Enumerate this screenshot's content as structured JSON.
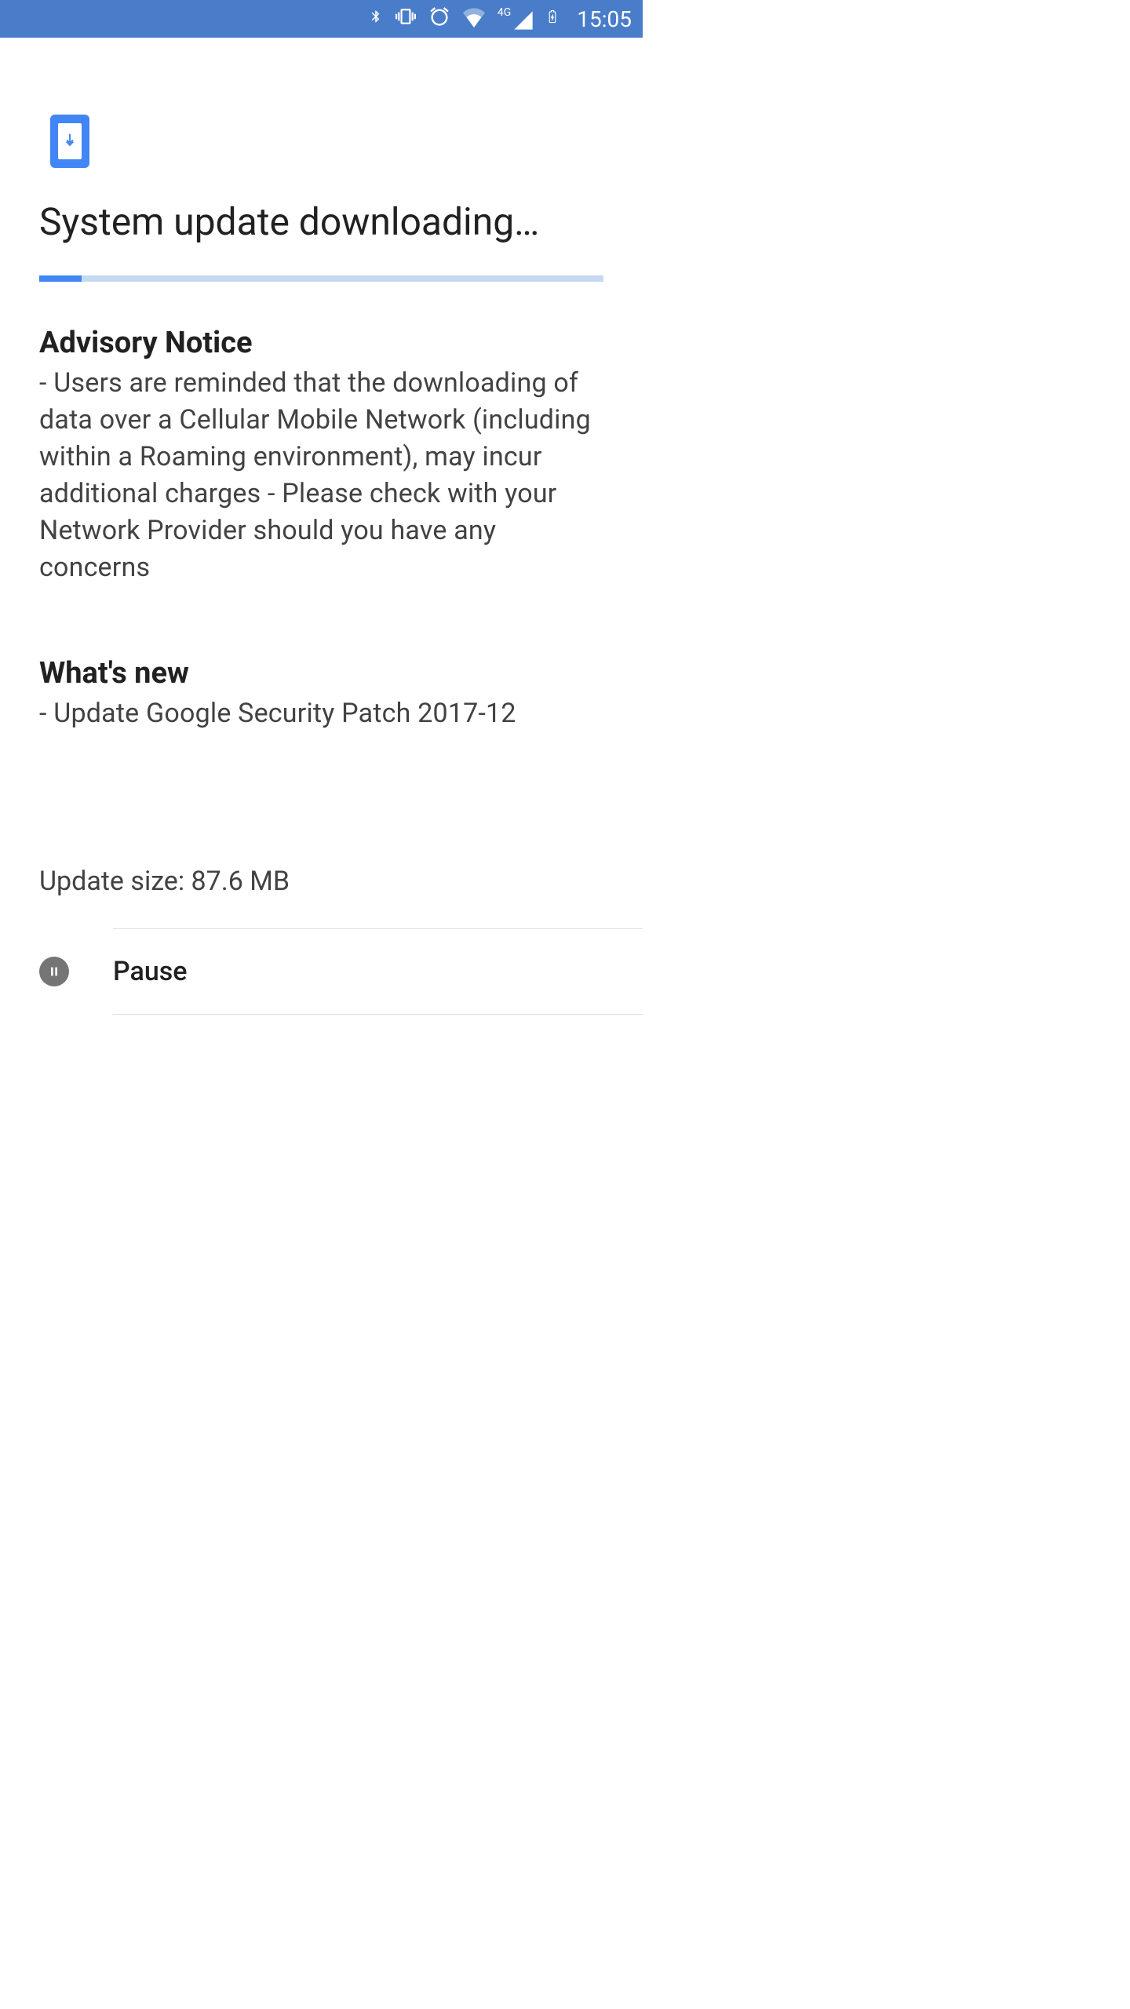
{
  "status_bar": {
    "time": "15:05",
    "cellular_label": "4G"
  },
  "main": {
    "title": "System update downloading…",
    "progress_percent": 7.5,
    "advisory": {
      "heading": "Advisory Notice",
      "body": "- Users are reminded that the downloading of data over a Cellular Mobile Network (including within a Roaming environment), may incur additional charges - Please check with your Network Provider should you have any concerns"
    },
    "whats_new": {
      "heading": "What's new",
      "body": "- Update Google Security Patch 2017-12"
    },
    "update_size": "Update size: 87.6 MB",
    "action": {
      "label": "Pause"
    }
  }
}
